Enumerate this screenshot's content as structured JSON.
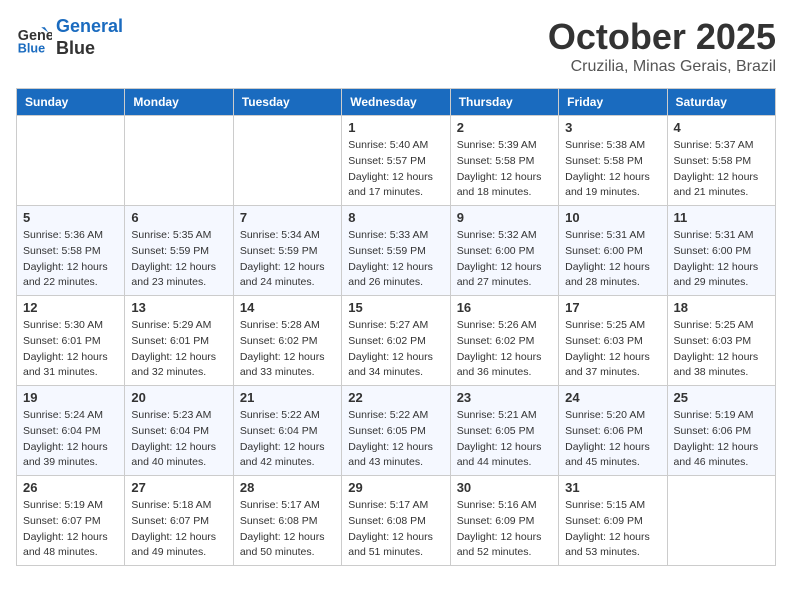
{
  "header": {
    "logo_line1": "General",
    "logo_line2": "Blue",
    "month_title": "October 2025",
    "location": "Cruzilia, Minas Gerais, Brazil"
  },
  "days_of_week": [
    "Sunday",
    "Monday",
    "Tuesday",
    "Wednesday",
    "Thursday",
    "Friday",
    "Saturday"
  ],
  "weeks": [
    [
      {
        "day": "",
        "info": ""
      },
      {
        "day": "",
        "info": ""
      },
      {
        "day": "",
        "info": ""
      },
      {
        "day": "1",
        "info": "Sunrise: 5:40 AM\nSunset: 5:57 PM\nDaylight: 12 hours and 17 minutes."
      },
      {
        "day": "2",
        "info": "Sunrise: 5:39 AM\nSunset: 5:58 PM\nDaylight: 12 hours and 18 minutes."
      },
      {
        "day": "3",
        "info": "Sunrise: 5:38 AM\nSunset: 5:58 PM\nDaylight: 12 hours and 19 minutes."
      },
      {
        "day": "4",
        "info": "Sunrise: 5:37 AM\nSunset: 5:58 PM\nDaylight: 12 hours and 21 minutes."
      }
    ],
    [
      {
        "day": "5",
        "info": "Sunrise: 5:36 AM\nSunset: 5:58 PM\nDaylight: 12 hours and 22 minutes."
      },
      {
        "day": "6",
        "info": "Sunrise: 5:35 AM\nSunset: 5:59 PM\nDaylight: 12 hours and 23 minutes."
      },
      {
        "day": "7",
        "info": "Sunrise: 5:34 AM\nSunset: 5:59 PM\nDaylight: 12 hours and 24 minutes."
      },
      {
        "day": "8",
        "info": "Sunrise: 5:33 AM\nSunset: 5:59 PM\nDaylight: 12 hours and 26 minutes."
      },
      {
        "day": "9",
        "info": "Sunrise: 5:32 AM\nSunset: 6:00 PM\nDaylight: 12 hours and 27 minutes."
      },
      {
        "day": "10",
        "info": "Sunrise: 5:31 AM\nSunset: 6:00 PM\nDaylight: 12 hours and 28 minutes."
      },
      {
        "day": "11",
        "info": "Sunrise: 5:31 AM\nSunset: 6:00 PM\nDaylight: 12 hours and 29 minutes."
      }
    ],
    [
      {
        "day": "12",
        "info": "Sunrise: 5:30 AM\nSunset: 6:01 PM\nDaylight: 12 hours and 31 minutes."
      },
      {
        "day": "13",
        "info": "Sunrise: 5:29 AM\nSunset: 6:01 PM\nDaylight: 12 hours and 32 minutes."
      },
      {
        "day": "14",
        "info": "Sunrise: 5:28 AM\nSunset: 6:02 PM\nDaylight: 12 hours and 33 minutes."
      },
      {
        "day": "15",
        "info": "Sunrise: 5:27 AM\nSunset: 6:02 PM\nDaylight: 12 hours and 34 minutes."
      },
      {
        "day": "16",
        "info": "Sunrise: 5:26 AM\nSunset: 6:02 PM\nDaylight: 12 hours and 36 minutes."
      },
      {
        "day": "17",
        "info": "Sunrise: 5:25 AM\nSunset: 6:03 PM\nDaylight: 12 hours and 37 minutes."
      },
      {
        "day": "18",
        "info": "Sunrise: 5:25 AM\nSunset: 6:03 PM\nDaylight: 12 hours and 38 minutes."
      }
    ],
    [
      {
        "day": "19",
        "info": "Sunrise: 5:24 AM\nSunset: 6:04 PM\nDaylight: 12 hours and 39 minutes."
      },
      {
        "day": "20",
        "info": "Sunrise: 5:23 AM\nSunset: 6:04 PM\nDaylight: 12 hours and 40 minutes."
      },
      {
        "day": "21",
        "info": "Sunrise: 5:22 AM\nSunset: 6:04 PM\nDaylight: 12 hours and 42 minutes."
      },
      {
        "day": "22",
        "info": "Sunrise: 5:22 AM\nSunset: 6:05 PM\nDaylight: 12 hours and 43 minutes."
      },
      {
        "day": "23",
        "info": "Sunrise: 5:21 AM\nSunset: 6:05 PM\nDaylight: 12 hours and 44 minutes."
      },
      {
        "day": "24",
        "info": "Sunrise: 5:20 AM\nSunset: 6:06 PM\nDaylight: 12 hours and 45 minutes."
      },
      {
        "day": "25",
        "info": "Sunrise: 5:19 AM\nSunset: 6:06 PM\nDaylight: 12 hours and 46 minutes."
      }
    ],
    [
      {
        "day": "26",
        "info": "Sunrise: 5:19 AM\nSunset: 6:07 PM\nDaylight: 12 hours and 48 minutes."
      },
      {
        "day": "27",
        "info": "Sunrise: 5:18 AM\nSunset: 6:07 PM\nDaylight: 12 hours and 49 minutes."
      },
      {
        "day": "28",
        "info": "Sunrise: 5:17 AM\nSunset: 6:08 PM\nDaylight: 12 hours and 50 minutes."
      },
      {
        "day": "29",
        "info": "Sunrise: 5:17 AM\nSunset: 6:08 PM\nDaylight: 12 hours and 51 minutes."
      },
      {
        "day": "30",
        "info": "Sunrise: 5:16 AM\nSunset: 6:09 PM\nDaylight: 12 hours and 52 minutes."
      },
      {
        "day": "31",
        "info": "Sunrise: 5:15 AM\nSunset: 6:09 PM\nDaylight: 12 hours and 53 minutes."
      },
      {
        "day": "",
        "info": ""
      }
    ]
  ]
}
